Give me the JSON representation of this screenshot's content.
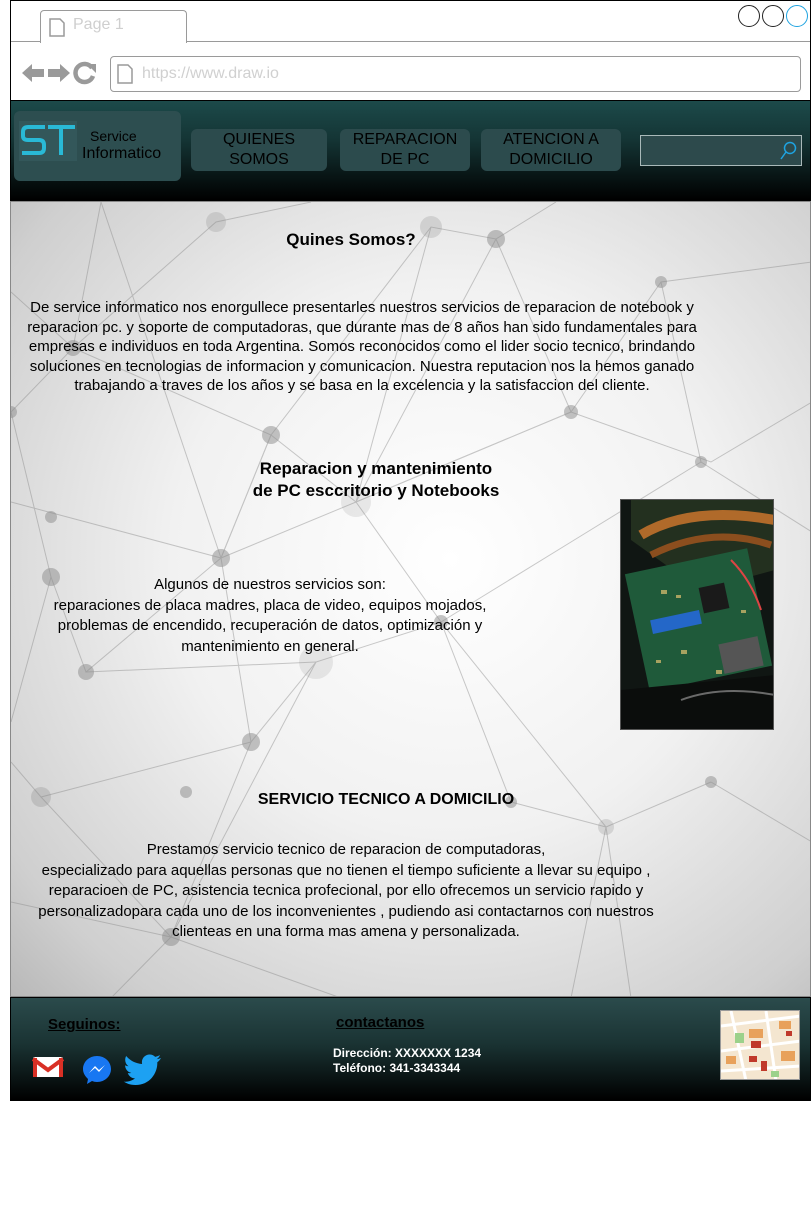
{
  "browser": {
    "tab_title": "Page 1",
    "url": "https://www.draw.io"
  },
  "header": {
    "logo_mark": "ST",
    "logo_line1": "Service",
    "logo_line2": "Informatico",
    "nav": [
      {
        "line1": "QUIENES",
        "line2": "SOMOS"
      },
      {
        "line1": "REPARACION",
        "line2": "DE PC"
      },
      {
        "line1": "ATENCION A",
        "line2": "DOMICILIO"
      }
    ],
    "search_value": ""
  },
  "main": {
    "section1": {
      "title": "Quines Somos?",
      "paragraph": "De service informatico nos enorgullece presentarles nuestros servicios de reparacion de notebook y reparacion pc. y soporte de computadoras, que durante mas de 8 años han sido fundamentales para empresas e individuos en toda Argentina. Somos reconocidos como el lider socio tecnico, brindando soluciones en tecnologias de informacion y comunicacion. Nuestra reputacion nos la hemos ganado trabajando a traves de los años y se basa en la excelencia y la satisfaccion del cliente."
    },
    "section2": {
      "title_line1": "Reparacion y mantenimiento",
      "title_line2": "de PC esccritorio y Notebooks",
      "intro": "Algunos de nuestros servicios son:",
      "paragraph": "reparaciones de placa madres, placa de video, equipos mojados, problemas de encendido, recuperación de datos, optimización y mantenimiento en general."
    },
    "section3": {
      "title": "SERVICIO TECNICO A DOMICILIO",
      "intro": "Prestamos servicio tecnico de reparacion de computadoras,",
      "paragraph": "especializado para aquellas personas que no tienen el tiempo suficiente a llevar su equipo , reparacioen de PC, asistencia tecnica profecional, por ello ofrecemos un servicio rapido y personalizadopara cada uno de los inconvenientes , pudiendo asi contactarnos con nuestros clienteas en una forma mas amena y personalizada."
    }
  },
  "footer": {
    "follow_label": "Seguinos:",
    "contact_label": "contactanos",
    "address": "Dirección: XXXXXXX 1234",
    "phone": "Teléfono: 341-3343344",
    "social_icons": [
      "gmail-icon",
      "messenger-icon",
      "twitter-icon"
    ]
  },
  "colors": {
    "header_top": "#1c4a4a",
    "nav_button": "#2c4b4d",
    "accent_blue": "#1ea3e0"
  }
}
